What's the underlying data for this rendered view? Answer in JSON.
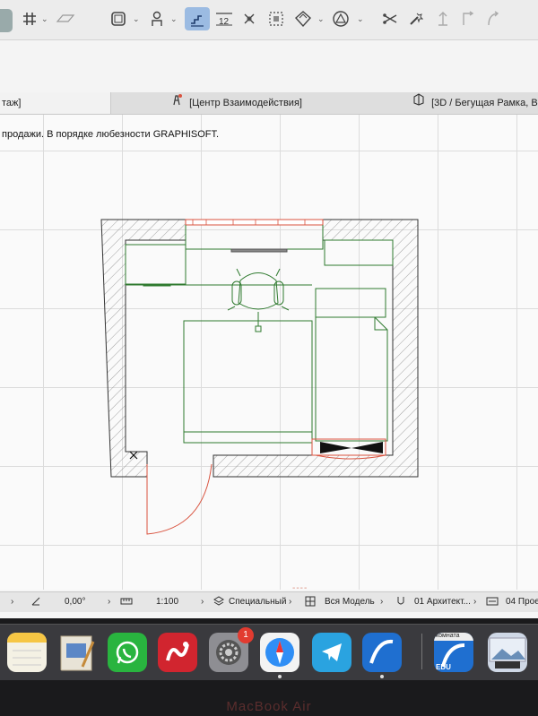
{
  "toolbar": {
    "tools": [
      "grid-icon",
      "slab-icon",
      "wall-icon",
      "object-icon",
      "stair-icon",
      "dimension-icon",
      "level-icon",
      "label-icon",
      "zone-icon",
      "mesh-icon",
      "morph-icon",
      "trim-icon",
      "magic-wand-icon",
      "railing-icon",
      "roof-icon",
      "curtain-wall-icon"
    ],
    "level_label": "12"
  },
  "tabs": {
    "left": "таж]",
    "middle": "[Центр Взаимодействия]",
    "right": "[3D / Бегущая Рамка, В"
  },
  "drag_handle": "----",
  "canvas": {
    "notice": "продажи. В порядке любезности GRAPHISOFT."
  },
  "statusbar": {
    "angle": "0,00°",
    "scale": "1:100",
    "layer_combo": "Специальный",
    "model_view": "Вся Модель",
    "pen_set": "01 Архитект...",
    "renovation": "04 Прое"
  },
  "dock": {
    "apps": [
      "notes-icon",
      "preview-icon",
      "whatsapp-icon",
      "drive-icon",
      "settings-icon",
      "safari-icon",
      "telegram-icon",
      "archicad-icon",
      "archicad-edu-icon",
      "photos-icon"
    ],
    "settings_badge": "1",
    "edu_label": "EDU",
    "edu_top_label": "комната"
  },
  "colors": {
    "wall_hatch": "#7a7a7a",
    "furniture": "#2f7a2f",
    "accent_red": "#d9533f",
    "selection": "#9bbbe2"
  }
}
